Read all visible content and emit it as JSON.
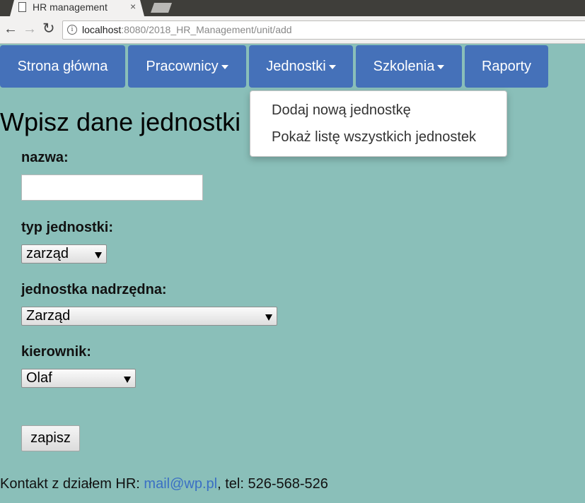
{
  "browser": {
    "tab_title": "HR management",
    "tab_close": "×",
    "back_glyph": "←",
    "forward_glyph": "→",
    "reload_glyph": "↻",
    "info_glyph": "i",
    "url_host": "localhost",
    "url_rest": ":8080/2018_HR_Management/unit/add"
  },
  "navbar": {
    "items": [
      {
        "label": "Strona główna",
        "dropdown": false
      },
      {
        "label": "Pracownicy",
        "dropdown": true
      },
      {
        "label": "Jednostki",
        "dropdown": true
      },
      {
        "label": "Szkolenia",
        "dropdown": true
      },
      {
        "label": "Raporty",
        "dropdown": false
      }
    ]
  },
  "dropdown": {
    "open_under": "Jednostki",
    "items": [
      {
        "label": "Dodaj nową jednostkę"
      },
      {
        "label": "Pokaż listę wszystkich jednostek"
      }
    ]
  },
  "form": {
    "title": "Wpisz dane jednostki",
    "name_label": "nazwa:",
    "name_value": "",
    "type_label": "typ jednostki:",
    "type_value": "zarząd",
    "parent_label": "jednostka nadrzędna:",
    "parent_value": "Zarząd",
    "manager_label": "kierownik:",
    "manager_value": "Olaf",
    "submit_label": "zapisz"
  },
  "footer": {
    "prefix": "Kontakt z działem HR: ",
    "email": "mail@wp.pl",
    "suffix": ", tel: 526-568-526"
  },
  "colors": {
    "page_background": "#8abfb9",
    "nav_button": "#4571b9",
    "link": "#3a6fc4"
  },
  "icons": [
    "doc-icon",
    "close-icon",
    "back-arrow-icon",
    "forward-arrow-icon",
    "reload-icon",
    "info-icon",
    "caret-down-icon",
    "select-arrow-icon"
  ]
}
